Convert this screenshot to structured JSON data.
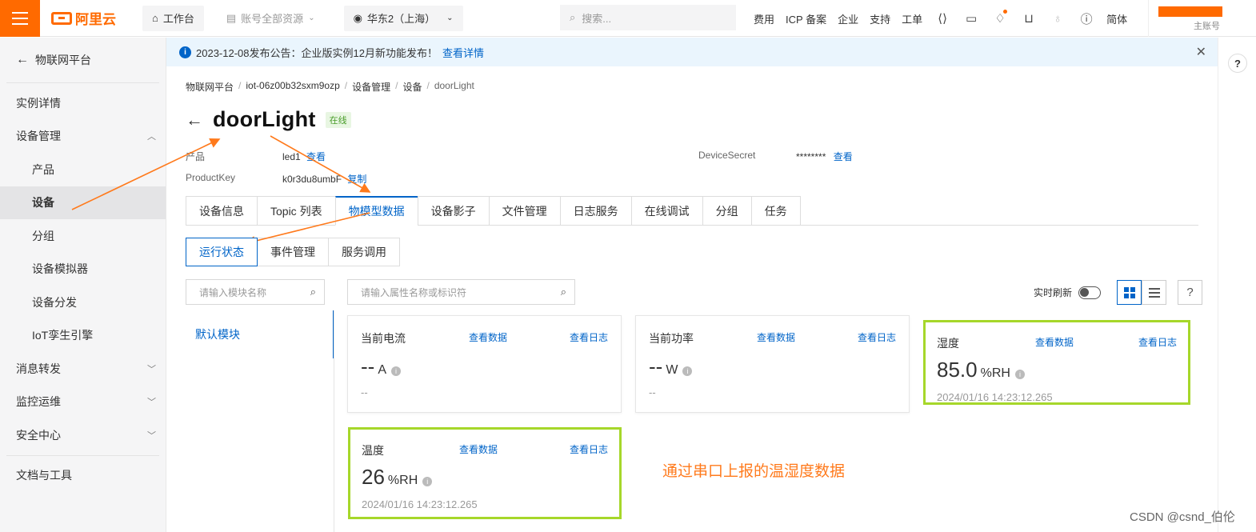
{
  "topbar": {
    "brand": "阿里云",
    "workbench": "工作台",
    "resources": "账号全部资源",
    "region": "华东2（上海）",
    "search_placeholder": "搜索...",
    "links": [
      "费用",
      "ICP 备案",
      "企业",
      "支持",
      "工单"
    ],
    "lang": "简体",
    "account_sub": "主账号",
    "brand_color": "#ff6a00"
  },
  "sidebar": {
    "back_label": "物联网平台",
    "items": [
      {
        "label": "实例详情",
        "type": "top"
      },
      {
        "label": "设备管理",
        "type": "group",
        "chevron": "up"
      },
      {
        "label": "产品",
        "type": "sub"
      },
      {
        "label": "设备",
        "type": "sub",
        "active": true
      },
      {
        "label": "分组",
        "type": "sub"
      },
      {
        "label": "设备模拟器",
        "type": "sub"
      },
      {
        "label": "设备分发",
        "type": "sub"
      },
      {
        "label": "IoT孪生引擎",
        "type": "sub"
      },
      {
        "label": "消息转发",
        "type": "group",
        "chevron": "down"
      },
      {
        "label": "监控运维",
        "type": "group",
        "chevron": "down"
      },
      {
        "label": "安全中心",
        "type": "group",
        "chevron": "down"
      }
    ],
    "footer_item": "文档与工具"
  },
  "notice": {
    "text": "2023-12-08发布公告：企业版实例12月新功能发布！",
    "link": "查看详情"
  },
  "breadcrumb": [
    "物联网平台",
    "iot-06z00b32sxm9ozp",
    "设备管理",
    "设备",
    "doorLight"
  ],
  "device": {
    "name": "doorLight",
    "status": "在线",
    "product_label": "产品",
    "product_value": "led1",
    "product_link": "查看",
    "productkey_label": "ProductKey",
    "productkey_value": "k0r3du8umbF",
    "productkey_link": "复制",
    "secret_label": "DeviceSecret",
    "secret_value": "********",
    "secret_link": "查看"
  },
  "tabs": [
    "设备信息",
    "Topic 列表",
    "物模型数据",
    "设备影子",
    "文件管理",
    "日志服务",
    "在线调试",
    "分组",
    "任务"
  ],
  "active_tab": "物模型数据",
  "subtabs": [
    "运行状态",
    "事件管理",
    "服务调用"
  ],
  "active_subtab": "运行状态",
  "module_search_placeholder": "请输入模块名称",
  "property_search_placeholder": "请输入属性名称或标识符",
  "module_default": "默认模块",
  "realtime_label": "实时刷新",
  "realtime_on": false,
  "cards": [
    {
      "name": "当前电流",
      "value": "--",
      "unit": "A",
      "time": "--",
      "highlight": false,
      "view_data": "查看数据",
      "view_log": "查看日志"
    },
    {
      "name": "当前功率",
      "value": "--",
      "unit": "W",
      "time": "--",
      "highlight": false,
      "view_data": "查看数据",
      "view_log": "查看日志"
    },
    {
      "name": "湿度",
      "value": "85.0",
      "unit": "%RH",
      "time": "2024/01/16 14:23:12.265",
      "highlight": true,
      "view_data": "查看数据",
      "view_log": "查看日志"
    },
    {
      "name": "温度",
      "value": "26",
      "unit": "%RH",
      "time": "2024/01/16 14:23:12.265",
      "highlight": true,
      "view_data": "查看数据",
      "view_log": "查看日志"
    }
  ],
  "annotation": "通过串口上报的温湿度数据",
  "watermark": "CSDN @csnd_伯伦",
  "colors": {
    "accent": "#0064c8",
    "highlight": "#a6d72a",
    "annotation": "#ff7a1c"
  }
}
